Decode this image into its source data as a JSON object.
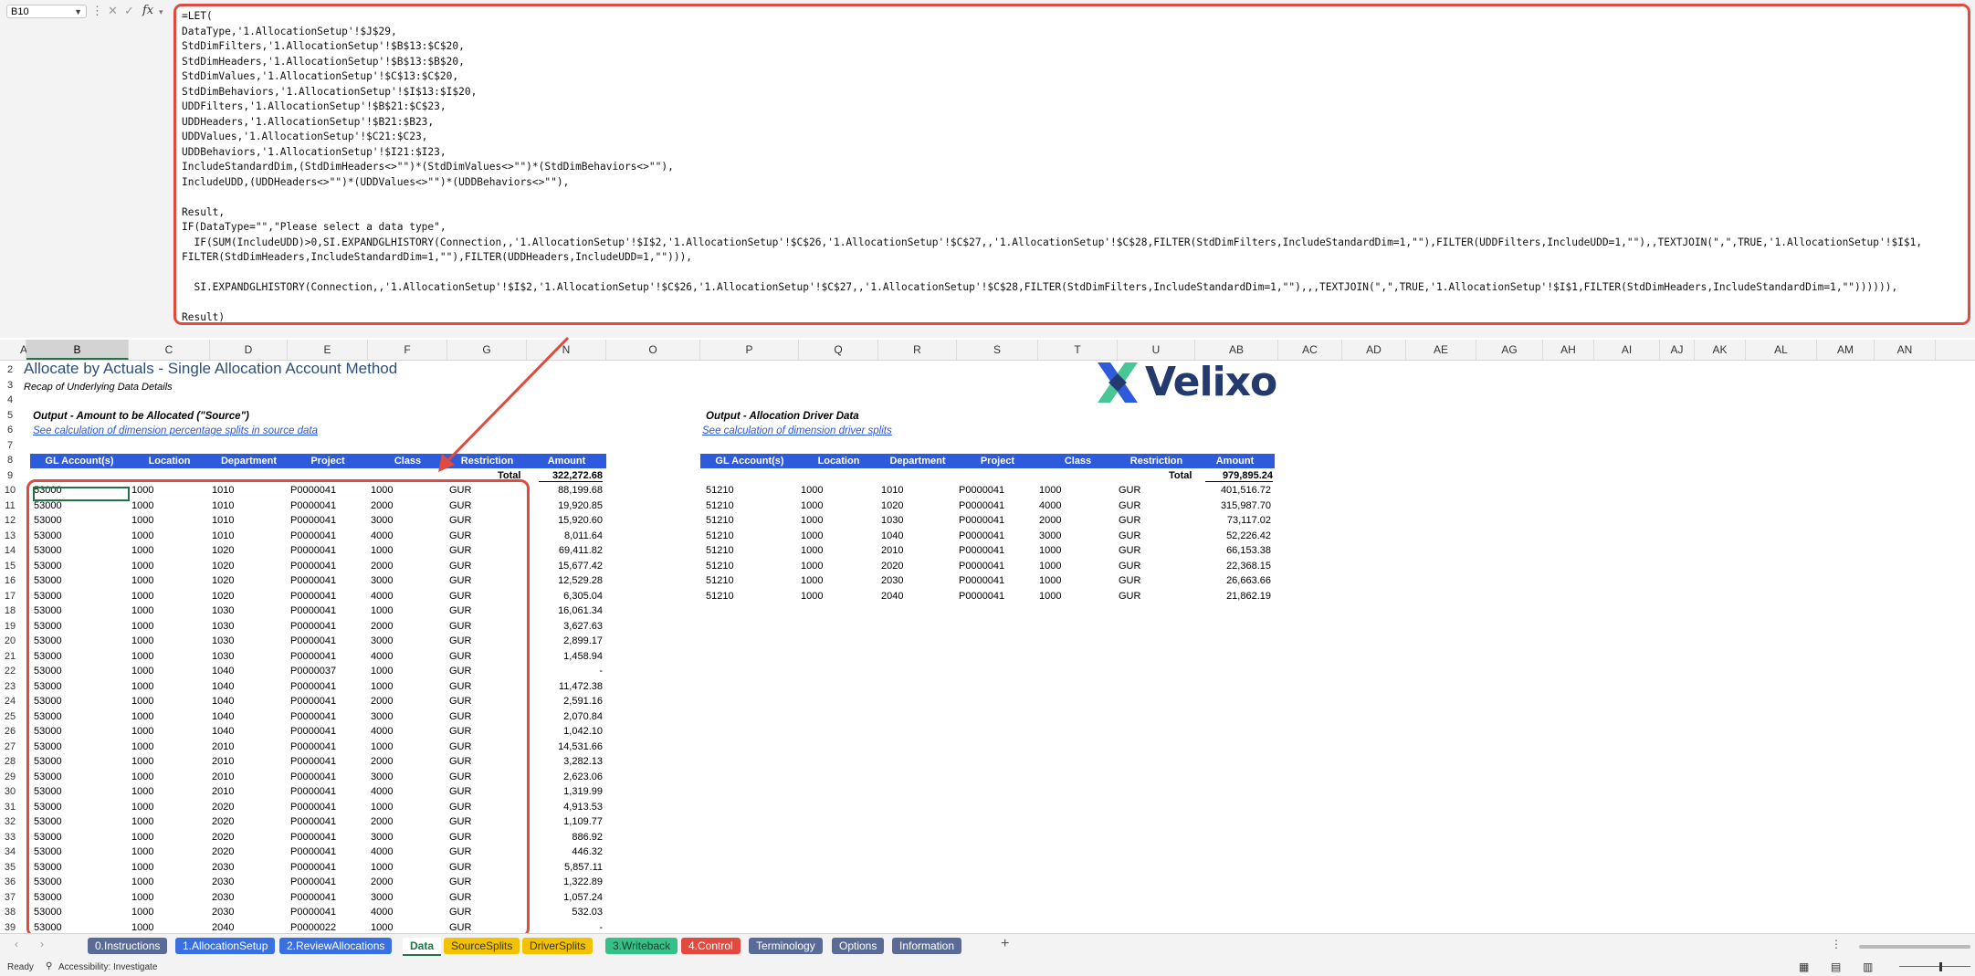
{
  "namebox": "B10",
  "formula_lines": [
    "=LET(",
    "DataType,'1.AllocationSetup'!$J$29,",
    "StdDimFilters,'1.AllocationSetup'!$B$13:$C$20,",
    "StdDimHeaders,'1.AllocationSetup'!$B$13:$B$20,",
    "StdDimValues,'1.AllocationSetup'!$C$13:$C$20,",
    "StdDimBehaviors,'1.AllocationSetup'!$I$13:$I$20,",
    "UDDFilters,'1.AllocationSetup'!$B$21:$C$23,",
    "UDDHeaders,'1.AllocationSetup'!$B21:$B23,",
    "UDDValues,'1.AllocationSetup'!$C21:$C23,",
    "UDDBehaviors,'1.AllocationSetup'!$I21:$I23,",
    "IncludeStandardDim,(StdDimHeaders<>\"\")*(StdDimValues<>\"\")*(StdDimBehaviors<>\"\"),",
    "IncludeUDD,(UDDHeaders<>\"\")*(UDDValues<>\"\")*(UDDBehaviors<>\"\"),",
    "",
    "Result,",
    "IF(DataType=\"\",\"Please select a data type\",",
    "  IF(SUM(IncludeUDD)>0,SI.EXPANDGLHISTORY(Connection,,'1.AllocationSetup'!$I$2,'1.AllocationSetup'!$C$26,'1.AllocationSetup'!$C$27,,'1.AllocationSetup'!$C$28,FILTER(StdDimFilters,IncludeStandardDim=1,\"\"),FILTER(UDDFilters,IncludeUDD=1,\"\"),,TEXTJOIN(\",\",TRUE,'1.AllocationSetup'!$I$1,",
    "FILTER(StdDimHeaders,IncludeStandardDim=1,\"\"),FILTER(UDDHeaders,IncludeUDD=1,\"\"))),",
    "",
    "  SI.EXPANDGLHISTORY(Connection,,'1.AllocationSetup'!$I$2,'1.AllocationSetup'!$C$26,'1.AllocationSetup'!$C$27,,'1.AllocationSetup'!$C$28,FILTER(StdDimFilters,IncludeStandardDim=1,\"\"),,,TEXTJOIN(\",\",TRUE,'1.AllocationSetup'!$I$1,FILTER(StdDimHeaders,IncludeStandardDim=1,\"\")))))),",
    "",
    "Result)"
  ],
  "columns": [
    "A",
    "B",
    "C",
    "D",
    "E",
    "F",
    "G",
    "N",
    "O",
    "P",
    "Q",
    "R",
    "S",
    "T",
    "U",
    "AB",
    "AC",
    "AD",
    "AE",
    "AG",
    "AH",
    "AI",
    "AJ",
    "AK",
    "AL",
    "AM",
    "AN"
  ],
  "sheet": {
    "title": "Allocate by Actuals - Single Allocation Account Method",
    "subtitle": "Recap of Underlying Data Details",
    "left_section": "Output - Amount to be Allocated (\"Source\")",
    "left_link": "See calculation of dimension percentage splits in source data",
    "right_section": "Output - Allocation Driver Data",
    "right_link": "See calculation of dimension driver splits",
    "headers": [
      "GL Account(s)",
      "Location",
      "Department",
      "Project",
      "Class",
      "Restriction",
      "Amount"
    ],
    "total_label": "Total",
    "left_total": "322,272.68",
    "right_total": "979,895.24",
    "brand": "Velixo"
  },
  "left_rows": [
    [
      "53000",
      "1000",
      "1010",
      "P0000041",
      "1000",
      "GUR",
      "88,199.68"
    ],
    [
      "53000",
      "1000",
      "1010",
      "P0000041",
      "2000",
      "GUR",
      "19,920.85"
    ],
    [
      "53000",
      "1000",
      "1010",
      "P0000041",
      "3000",
      "GUR",
      "15,920.60"
    ],
    [
      "53000",
      "1000",
      "1010",
      "P0000041",
      "4000",
      "GUR",
      "8,011.64"
    ],
    [
      "53000",
      "1000",
      "1020",
      "P0000041",
      "1000",
      "GUR",
      "69,411.82"
    ],
    [
      "53000",
      "1000",
      "1020",
      "P0000041",
      "2000",
      "GUR",
      "15,677.42"
    ],
    [
      "53000",
      "1000",
      "1020",
      "P0000041",
      "3000",
      "GUR",
      "12,529.28"
    ],
    [
      "53000",
      "1000",
      "1020",
      "P0000041",
      "4000",
      "GUR",
      "6,305.04"
    ],
    [
      "53000",
      "1000",
      "1030",
      "P0000041",
      "1000",
      "GUR",
      "16,061.34"
    ],
    [
      "53000",
      "1000",
      "1030",
      "P0000041",
      "2000",
      "GUR",
      "3,627.63"
    ],
    [
      "53000",
      "1000",
      "1030",
      "P0000041",
      "3000",
      "GUR",
      "2,899.17"
    ],
    [
      "53000",
      "1000",
      "1030",
      "P0000041",
      "4000",
      "GUR",
      "1,458.94"
    ],
    [
      "53000",
      "1000",
      "1040",
      "P0000037",
      "1000",
      "GUR",
      "-"
    ],
    [
      "53000",
      "1000",
      "1040",
      "P0000041",
      "1000",
      "GUR",
      "11,472.38"
    ],
    [
      "53000",
      "1000",
      "1040",
      "P0000041",
      "2000",
      "GUR",
      "2,591.16"
    ],
    [
      "53000",
      "1000",
      "1040",
      "P0000041",
      "3000",
      "GUR",
      "2,070.84"
    ],
    [
      "53000",
      "1000",
      "1040",
      "P0000041",
      "4000",
      "GUR",
      "1,042.10"
    ],
    [
      "53000",
      "1000",
      "2010",
      "P0000041",
      "1000",
      "GUR",
      "14,531.66"
    ],
    [
      "53000",
      "1000",
      "2010",
      "P0000041",
      "2000",
      "GUR",
      "3,282.13"
    ],
    [
      "53000",
      "1000",
      "2010",
      "P0000041",
      "3000",
      "GUR",
      "2,623.06"
    ],
    [
      "53000",
      "1000",
      "2010",
      "P0000041",
      "4000",
      "GUR",
      "1,319.99"
    ],
    [
      "53000",
      "1000",
      "2020",
      "P0000041",
      "1000",
      "GUR",
      "4,913.53"
    ],
    [
      "53000",
      "1000",
      "2020",
      "P0000041",
      "2000",
      "GUR",
      "1,109.77"
    ],
    [
      "53000",
      "1000",
      "2020",
      "P0000041",
      "3000",
      "GUR",
      "886.92"
    ],
    [
      "53000",
      "1000",
      "2020",
      "P0000041",
      "4000",
      "GUR",
      "446.32"
    ],
    [
      "53000",
      "1000",
      "2030",
      "P0000041",
      "1000",
      "GUR",
      "5,857.11"
    ],
    [
      "53000",
      "1000",
      "2030",
      "P0000041",
      "2000",
      "GUR",
      "1,322.89"
    ],
    [
      "53000",
      "1000",
      "2030",
      "P0000041",
      "3000",
      "GUR",
      "1,057.24"
    ],
    [
      "53000",
      "1000",
      "2030",
      "P0000041",
      "4000",
      "GUR",
      "532.03"
    ],
    [
      "53000",
      "1000",
      "2040",
      "P0000022",
      "1000",
      "GUR",
      "-"
    ]
  ],
  "right_rows": [
    [
      "51210",
      "1000",
      "1010",
      "P0000041",
      "1000",
      "GUR",
      "401,516.72"
    ],
    [
      "51210",
      "1000",
      "1020",
      "P0000041",
      "4000",
      "GUR",
      "315,987.70"
    ],
    [
      "51210",
      "1000",
      "1030",
      "P0000041",
      "2000",
      "GUR",
      "73,117.02"
    ],
    [
      "51210",
      "1000",
      "1040",
      "P0000041",
      "3000",
      "GUR",
      "52,226.42"
    ],
    [
      "51210",
      "1000",
      "2010",
      "P0000041",
      "1000",
      "GUR",
      "66,153.38"
    ],
    [
      "51210",
      "1000",
      "2020",
      "P0000041",
      "1000",
      "GUR",
      "22,368.15"
    ],
    [
      "51210",
      "1000",
      "2030",
      "P0000041",
      "1000",
      "GUR",
      "26,663.66"
    ],
    [
      "51210",
      "1000",
      "2040",
      "P0000041",
      "1000",
      "GUR",
      "21,862.19"
    ]
  ],
  "tabs": [
    {
      "label": "0.Instructions",
      "color": "#5b6b97"
    },
    {
      "label": "1.AllocationSetup",
      "color": "#3a6fe0"
    },
    {
      "label": "2.ReviewAllocations",
      "color": "#3a6fe0"
    },
    {
      "label": "Data",
      "color": "#ffffff"
    },
    {
      "label": "SourceSplits",
      "color": "#f2c200"
    },
    {
      "label": "DriverSplits",
      "color": "#f2c200"
    },
    {
      "label": "3.Writeback",
      "color": "#35c08a"
    },
    {
      "label": "4.Control",
      "color": "#e04a3f"
    },
    {
      "label": "Terminology",
      "color": "#5b6b97"
    },
    {
      "label": "Options",
      "color": "#5b6b97"
    },
    {
      "label": "Information",
      "color": "#5b6b97"
    }
  ],
  "status": {
    "ready": "Ready",
    "accessibility": "Accessibility: Investigate"
  }
}
